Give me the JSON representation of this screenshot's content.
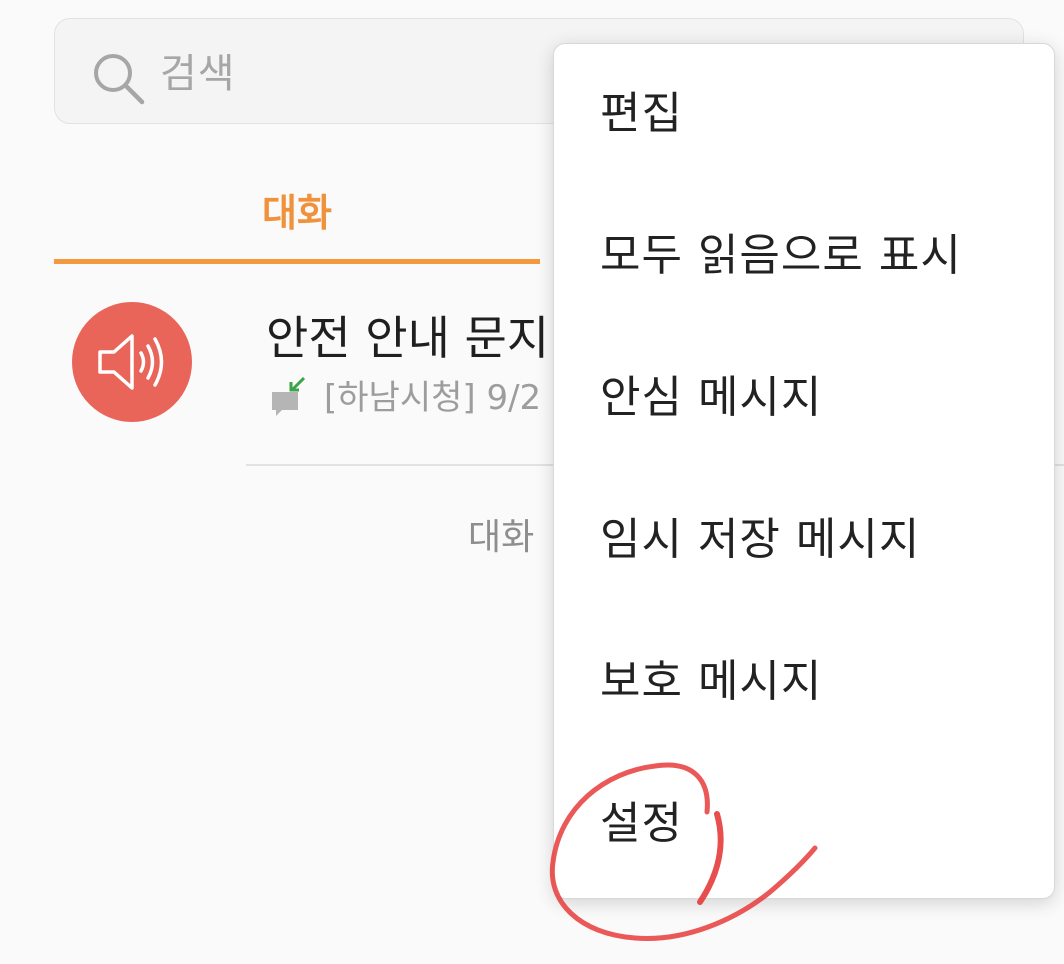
{
  "colors": {
    "accent": "#f39a40",
    "accent_text": "#f0913c",
    "avatar_bg": "#e9655a",
    "annotation": "#e63b3b",
    "incoming_arrow": "#3aa547"
  },
  "search": {
    "icon": "search-icon",
    "placeholder": "검색"
  },
  "tabs": [
    {
      "label": "대화",
      "active": true
    }
  ],
  "conversations": [
    {
      "avatar_icon": "speaker-icon",
      "title": "안전 안내 문지",
      "type_icon": "incoming-message-icon",
      "snippet": "[하남시청] 9/2"
    }
  ],
  "footer": {
    "count_label": "대화"
  },
  "menu": {
    "items": [
      {
        "label": "편집"
      },
      {
        "label": "모두 읽음으로 표시"
      },
      {
        "label": "안심 메시지"
      },
      {
        "label": "임시 저장 메시지"
      },
      {
        "label": "보호 메시지"
      },
      {
        "label": "설정",
        "highlighted": true
      }
    ]
  }
}
